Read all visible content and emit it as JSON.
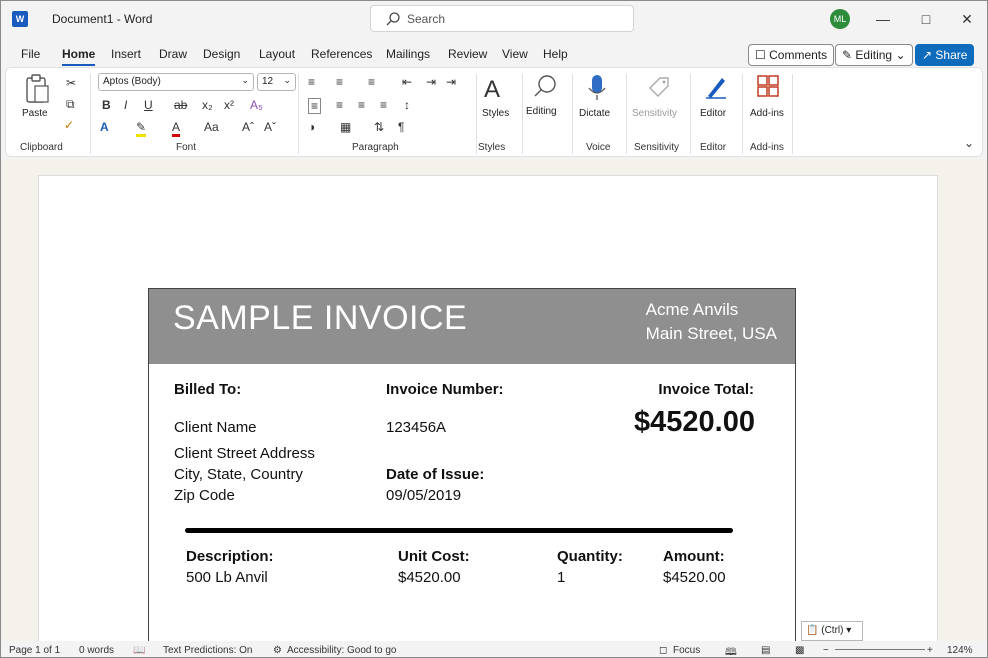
{
  "titlebar": {
    "app_icon": "W",
    "doc_title": "Document1  -  Word",
    "search_placeholder": "Search",
    "avatar": "ML"
  },
  "menu": {
    "tabs": [
      "File",
      "Home",
      "Insert",
      "Draw",
      "Design",
      "Layout",
      "References",
      "Mailings",
      "Review",
      "View",
      "Help"
    ],
    "active": "Home",
    "comments": "Comments",
    "editing": "Editing",
    "share": "Share"
  },
  "ribbon": {
    "paste": "Paste",
    "font_name": "Aptos (Body)",
    "font_size": "12",
    "styles": "Styles",
    "editing": "Editing",
    "dictate": "Dictate",
    "sensitivity": "Sensitivity",
    "editor": "Editor",
    "addins": "Add-ins",
    "groups": {
      "clipboard": "Clipboard",
      "font": "Font",
      "paragraph": "Paragraph",
      "styles": "Styles",
      "voice": "Voice",
      "sensitivity": "Sensitivity",
      "editor": "Editor",
      "addins": "Add-ins"
    }
  },
  "invoice": {
    "title": "SAMPLE INVOICE",
    "company_line1": "Acme Anvils",
    "company_line2": "Main Street, USA",
    "billed_to_label": "Billed To:",
    "client_name": "Client Name",
    "client_street": "Client Street Address",
    "client_city": "City, State, Country",
    "client_zip": "Zip Code",
    "invoice_number_label": "Invoice Number:",
    "invoice_number": "123456A",
    "date_label": "Date of Issue:",
    "date": "09/05/2019",
    "total_label": "Invoice Total:",
    "total": "$4520.00",
    "columns": {
      "description": "Description:",
      "unit_cost": "Unit Cost:",
      "quantity": "Quantity:",
      "amount": "Amount:"
    },
    "line_item": {
      "description": "500 Lb Anvil",
      "unit_cost": "$4520.00",
      "quantity": "1",
      "amount": "$4520.00"
    }
  },
  "paste_options": "(Ctrl)",
  "statusbar": {
    "page": "Page 1 of 1",
    "words": "0 words",
    "text_predictions": "Text Predictions: On",
    "accessibility": "Accessibility: Good to go",
    "focus": "Focus",
    "zoom": "124%"
  }
}
